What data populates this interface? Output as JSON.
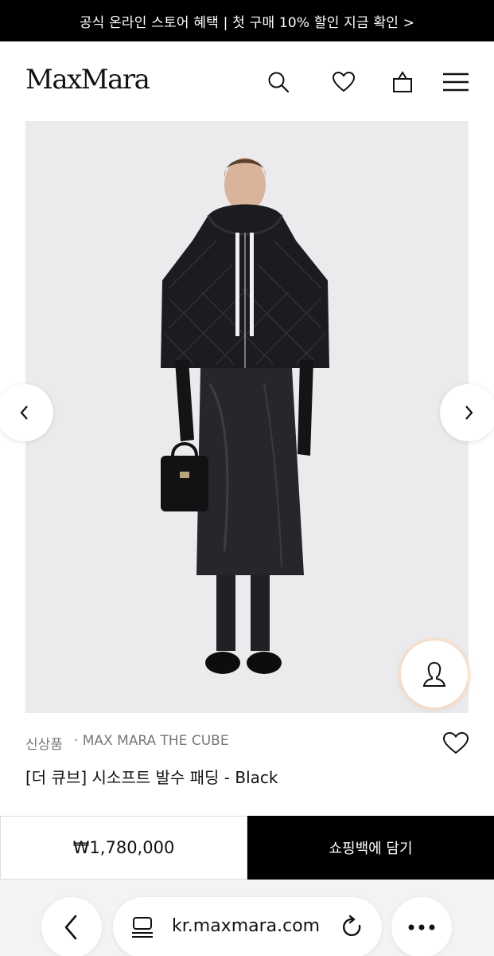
{
  "promo": {
    "text": "공식 온라인 스토어 혜택 | 첫 구매 10% 할인 지금 확인 >"
  },
  "header": {
    "logo": "MaxMara",
    "icons": [
      "search-icon",
      "heart-icon",
      "shopping-bag-icon",
      "menu-icon"
    ]
  },
  "gallery": {
    "image_alt": "Model wearing black quilted hooded down jacket with leather skirt",
    "prev_icon": "chevron-left-icon",
    "next_icon": "chevron-right-icon",
    "assist_icon": "person-icon"
  },
  "product": {
    "badge": "신상품",
    "collection": "· MAX MARA THE CUBE",
    "name": "[더 큐브] 시소프트 발수 패딩 - Black",
    "price": "₩1,780,000"
  },
  "actions": {
    "add_to_bag": "쇼핑백에 담기"
  },
  "browser": {
    "url": "kr.maxmara.com"
  },
  "colors": {
    "brand_black": "#000000",
    "gallery_bg": "#ebebed",
    "browser_bg": "#f3f3f3"
  }
}
